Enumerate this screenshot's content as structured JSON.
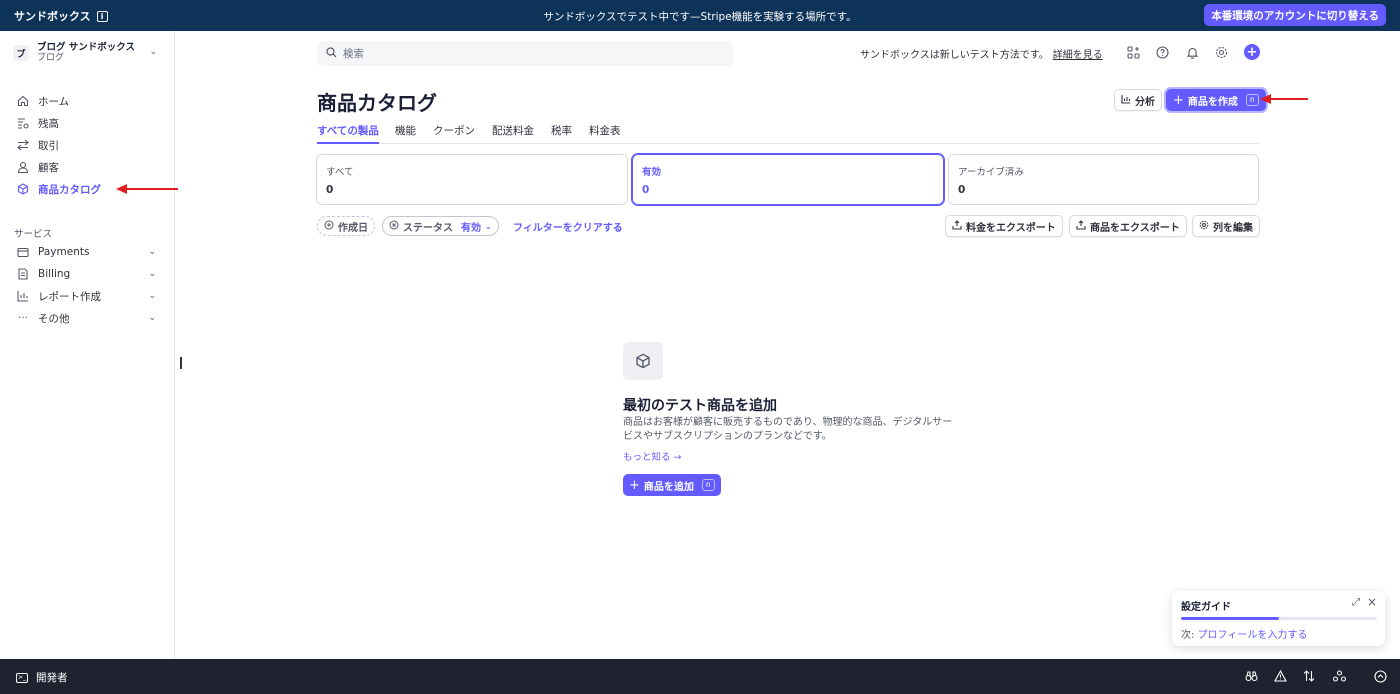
{
  "topbar": {
    "brand": "サンドボックス",
    "info_glyph": "i",
    "message": "サンドボックスでテスト中です—Stripe機能を実験する場所です。",
    "switch_button": "本番環境のアカウントに切り替える"
  },
  "account": {
    "logo_letter": "ブ",
    "name": "ブログ サンドボックス",
    "subtitle": "ブログ"
  },
  "sidebar": {
    "items": [
      {
        "label": "ホーム",
        "icon": "home-icon"
      },
      {
        "label": "残高",
        "icon": "balance-icon"
      },
      {
        "label": "取引",
        "icon": "transactions-icon"
      },
      {
        "label": "顧客",
        "icon": "customer-icon"
      },
      {
        "label": "商品カタログ",
        "icon": "product-box-icon",
        "active": true
      }
    ],
    "section_label": "サービス",
    "services": [
      {
        "label": "Payments",
        "icon": "payments-icon"
      },
      {
        "label": "Billing",
        "icon": "billing-icon"
      },
      {
        "label": "レポート作成",
        "icon": "reports-icon"
      },
      {
        "label": "その他",
        "icon": "more-icon"
      }
    ]
  },
  "header": {
    "search_placeholder": "検索",
    "message": "サンドボックスは新しいテスト方法です。",
    "message_link": "詳細を見る"
  },
  "page": {
    "title": "商品カタログ",
    "analyze_button": "分析",
    "create_button": "商品を作成",
    "create_shortcut": "n"
  },
  "tabs": [
    "すべての製品",
    "機能",
    "クーポン",
    "配送料金",
    "税率",
    "料金表"
  ],
  "status_cards": [
    {
      "label": "すべて",
      "value": "0"
    },
    {
      "label": "有効",
      "value": "0",
      "selected": true
    },
    {
      "label": "アーカイブ済み",
      "value": "0"
    }
  ],
  "filters": {
    "created_date": "作成日",
    "status_label": "ステータス",
    "status_value": "有効",
    "clear": "フィルターをクリアする"
  },
  "actions": {
    "export_prices": "料金をエクスポート",
    "export_products": "商品をエクスポート",
    "edit_columns": "列を編集"
  },
  "empty_state": {
    "title": "最初のテスト商品を追加",
    "description": "商品はお客様が顧客に販売するものであり、物理的な商品、デジタルサービスやサブスクリプションのプランなどです。",
    "learn_more": "もっと知る →",
    "add_button": "商品を追加",
    "add_shortcut": "n"
  },
  "setup_guide": {
    "title": "設定ガイド",
    "progress": 0.5,
    "next_prefix": "次: ",
    "next_link": "プロフィールを入力する"
  },
  "bottombar": {
    "developer": "開発者"
  },
  "colors": {
    "accent": "#635bff",
    "topbar": "#0d3358",
    "bottombar": "#1f2330",
    "annotation_arrow": "#e01e1e"
  }
}
